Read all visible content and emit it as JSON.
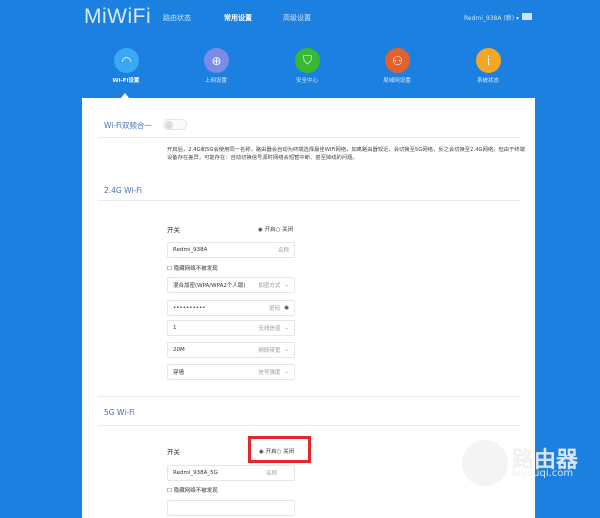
{
  "header": {
    "logo": "MiWiFi",
    "nav": [
      "路由状态",
      "常用设置",
      "高级设置"
    ],
    "active_nav": 1,
    "router_name": "Redmi_938A (新)"
  },
  "icons": [
    {
      "label": "Wi-Fi设置",
      "icon": "wifi-icon",
      "color": "#3ba8f5"
    },
    {
      "label": "上网设置",
      "icon": "globe-icon",
      "color": "#7a8ce8"
    },
    {
      "label": "安全中心",
      "icon": "shield-icon",
      "color": "#3bb832"
    },
    {
      "label": "局域网设置",
      "icon": "network-icon",
      "color": "#e2622e"
    },
    {
      "label": "系统状态",
      "icon": "info-icon",
      "color": "#f5a623"
    }
  ],
  "dual": {
    "label": "Wi-Fi双频合一",
    "enabled": false,
    "description": "开启后，2.4G和5G会使用同一名称，路由器会自动为终端选择最佳WiFi网络，如离路由器较近，会切换至5G网络，反之会切换至2.4G网络。但由于终端设备存在差异，可能存在：自动切换信号源时网络会短暂中断、甚至掉线的问题。"
  },
  "wifi24": {
    "title": "2.4G Wi-Fi",
    "switch_label": "开关",
    "on": "开启",
    "off": "关闭",
    "name": "Redmi_938A",
    "name_hint": "名称",
    "hide": "隐藏网络不被发现",
    "encryption": "混合加密(WPA/WPA2个人版)",
    "encryption_hint": "加密方式",
    "password": "••••••••••",
    "password_hint": "密码",
    "channel": "1",
    "channel_hint": "无线信道",
    "bandwidth": "20M",
    "bandwidth_hint": "频段带宽",
    "signal": "穿墙",
    "signal_hint": "信号强度"
  },
  "wifi5": {
    "title": "5G Wi-Fi",
    "switch_label": "开关",
    "on": "开启",
    "off": "关闭",
    "name": "Redmi_938A_5G",
    "name_hint": "名称",
    "hide": "隐藏网络不被发现"
  },
  "watermark": {
    "text": "路由器",
    "url": "luyouqi.com"
  }
}
